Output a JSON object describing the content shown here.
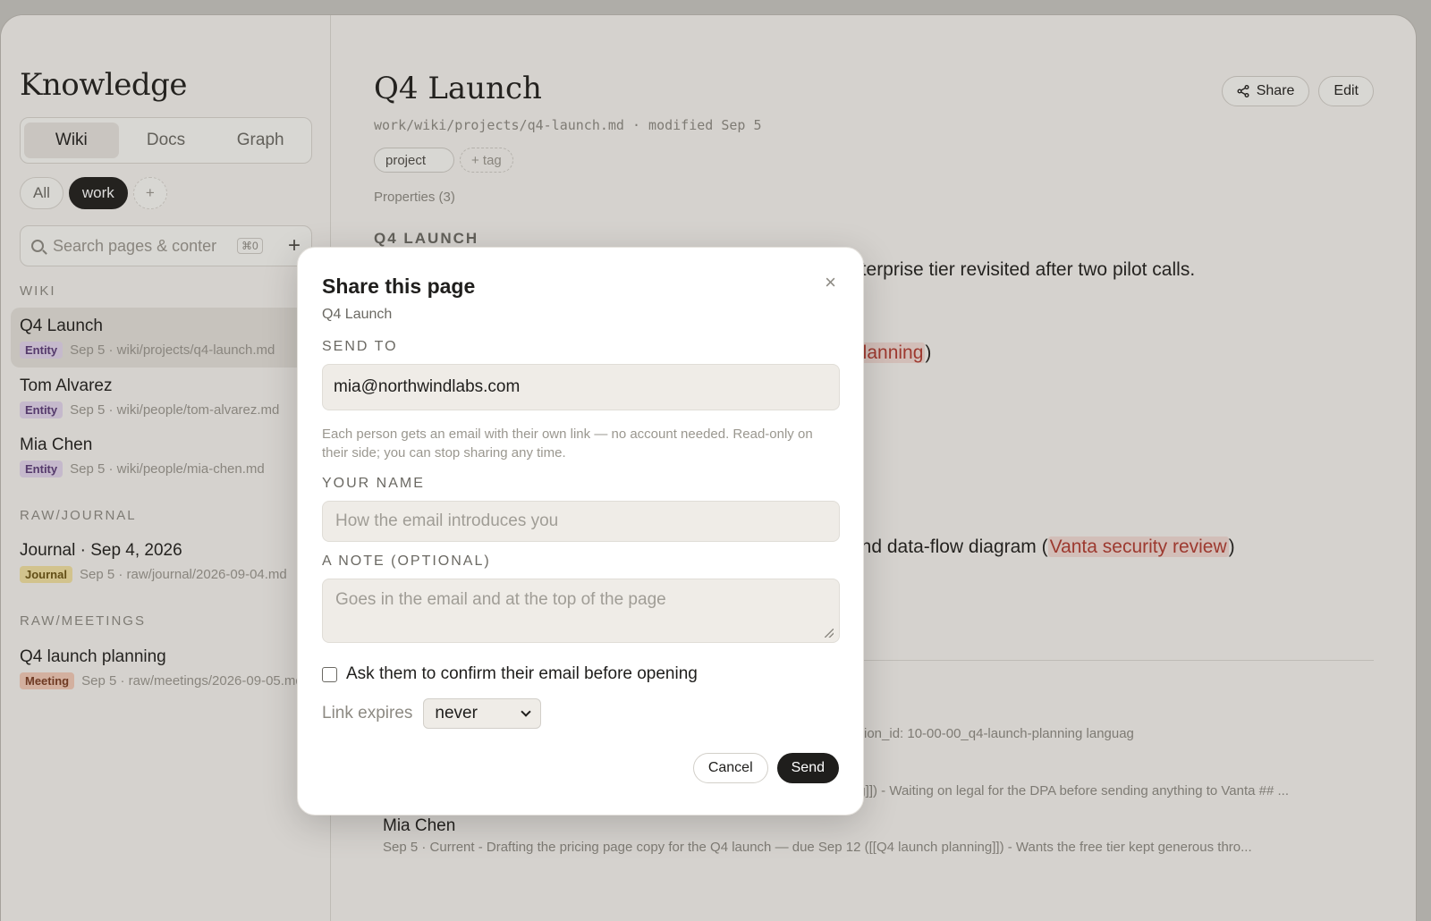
{
  "sidebar": {
    "app_title": "Knowledge",
    "tabs": [
      {
        "label": "Wiki",
        "active": true
      },
      {
        "label": "Docs",
        "active": false
      },
      {
        "label": "Graph",
        "active": false
      }
    ],
    "filters": [
      {
        "label": "All",
        "active": false
      },
      {
        "label": "work",
        "active": true
      },
      {
        "label": "+"
      }
    ],
    "search": {
      "placeholder": "Search pages & conter",
      "shortcut": "⌘0",
      "add_label": "+"
    },
    "sections": [
      {
        "label": "WIKI",
        "items": [
          {
            "title": "Q4 Launch",
            "badge": "Entity",
            "meta": "Sep 5 · wiki/projects/q4-launch.md"
          },
          {
            "title": "Tom Alvarez",
            "badge": "Entity",
            "meta": "Sep 5 · wiki/people/tom-alvarez.md"
          },
          {
            "title": "Mia Chen",
            "badge": "Entity",
            "meta": "Sep 5 · wiki/people/mia-chen.md"
          }
        ]
      },
      {
        "label": "RAW/JOURNAL",
        "items": [
          {
            "title": "Journal · Sep 4, 2026",
            "badge": "Journal",
            "meta": "Sep 5 · raw/journal/2026-09-04.md"
          }
        ]
      },
      {
        "label": "RAW/MEETINGS",
        "items": [
          {
            "title": "Q4 launch planning",
            "badge": "Meeting",
            "meta": "Sep 5 · raw/meetings/2026-09-05.md"
          }
        ]
      }
    ]
  },
  "main": {
    "title": "Q4 Launch",
    "path": "work/wiki/projects/q4-launch.md · modified Sep 5",
    "tags": [
      "project",
      "+ tag"
    ],
    "properties": "Properties (3)",
    "heading": "Q4 LAUNCH",
    "line1": "nterprise tier revisited after two pilot calls.",
    "line2_link": "planning",
    "line2_tail": ")",
    "line3_pre": "and data-flow diagram (",
    "line3_link": "Vanta security review",
    "line3_tail": ")",
    "small1": "ssion_id: 10-00-00_q4-launch-planning languag",
    "small2": "ng]]) - Waiting on legal for the DPA before sending anything to Vanta ## ...",
    "backlink_title": "Mia Chen",
    "backlink_meta": "Sep 5 · Current - Drafting the pricing page copy for the Q4 launch — due Sep 12 ([[Q4 launch planning]]) - Wants the free tier kept generous thro...",
    "share_label": "Share",
    "edit_label": "Edit"
  },
  "modal": {
    "title": "Share this page",
    "subtitle": "Q4 Launch",
    "close": "×",
    "send_to_label": "SEND TO",
    "send_to_value": "mia@northwindlabs.com",
    "help": "Each person gets an email with their own link — no account needed. Read-only on their side; you can stop sharing any time.",
    "name_label": "YOUR NAME",
    "name_placeholder": "How the email introduces you",
    "note_label": "A NOTE (OPTIONAL)",
    "note_placeholder": "Goes in the email and at the top of the page",
    "confirm_label": "Ask them to confirm their email before opening",
    "confirm_checked": false,
    "expires_label": "Link expires",
    "expires_value": "never",
    "cancel_label": "Cancel",
    "send_label": "Send"
  }
}
